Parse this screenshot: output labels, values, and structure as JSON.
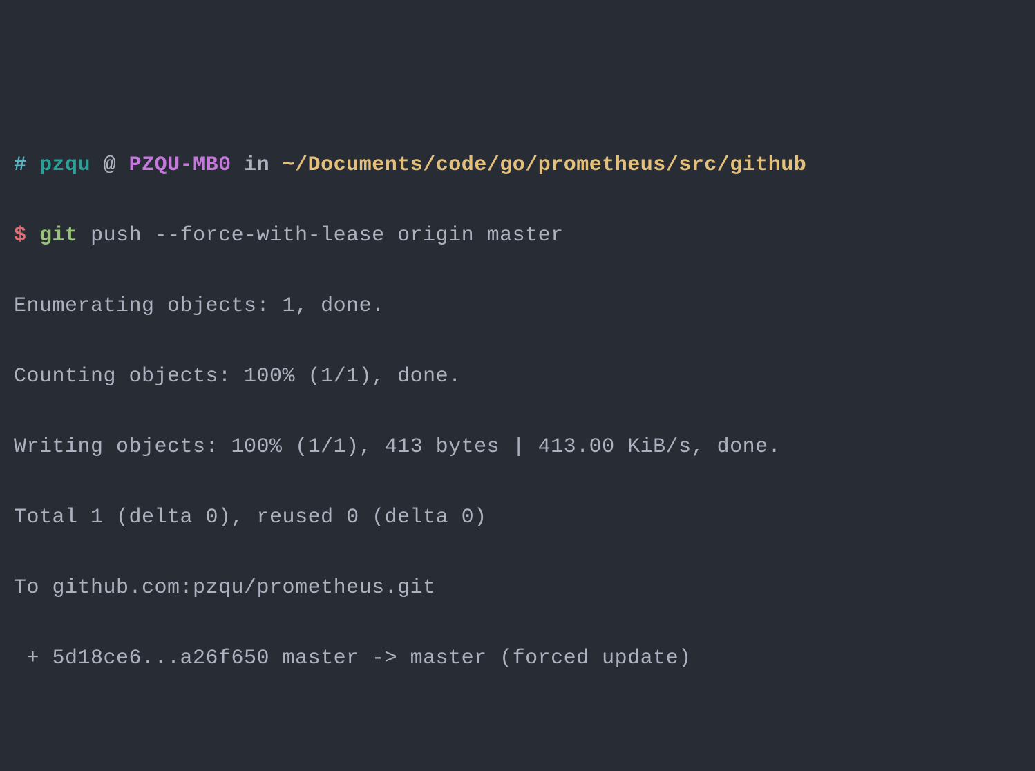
{
  "prompt": {
    "hash": "#",
    "user": "pzqu",
    "at": "@",
    "host": "PZQU-MB0",
    "in": "in",
    "path": "~/Documents/code/go/prometheus/src/github"
  },
  "command": {
    "dollar": "$",
    "git": "git",
    "args": "push --force-with-lease origin master"
  },
  "output": {
    "line1": "Enumerating objects: 1, done.",
    "line2": "Counting objects: 100% (1/1), done.",
    "line3": "Writing objects: 100% (1/1), 413 bytes | 413.00 KiB/s, done.",
    "line4": "Total 1 (delta 0), reused 0 (delta 0)",
    "line5": "To github.com:pzqu/prometheus.git",
    "line6": " + 5d18ce6...a26f650 master -> master (forced update)"
  }
}
